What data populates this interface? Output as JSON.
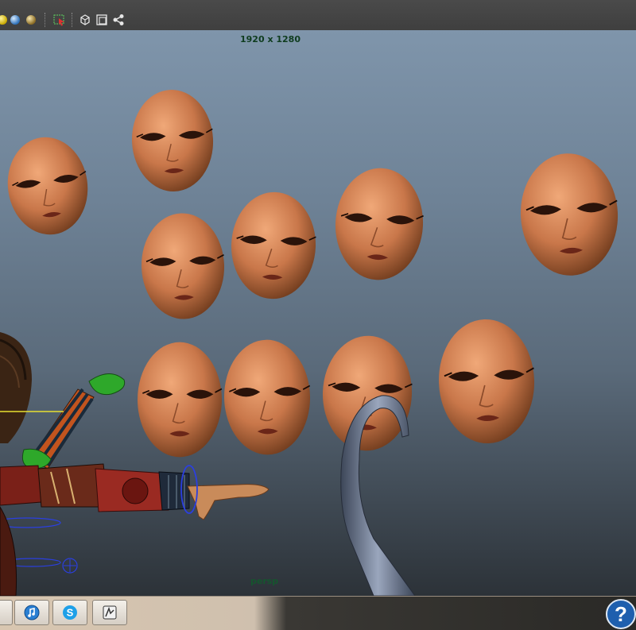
{
  "viewport": {
    "resolution_label": "1920 x 1280",
    "camera_label": "persp"
  },
  "toolbar": {
    "icons": [
      "material-ball-yellow-icon",
      "material-ball-blue-icon",
      "material-ball-gold-icon",
      "select-icon",
      "cube-icon",
      "frame-icon",
      "share-icon"
    ]
  },
  "taskbar": {
    "buttons": [
      "itunes-icon",
      "skype-icon",
      "app-icon"
    ]
  },
  "help": {
    "label": "?"
  }
}
